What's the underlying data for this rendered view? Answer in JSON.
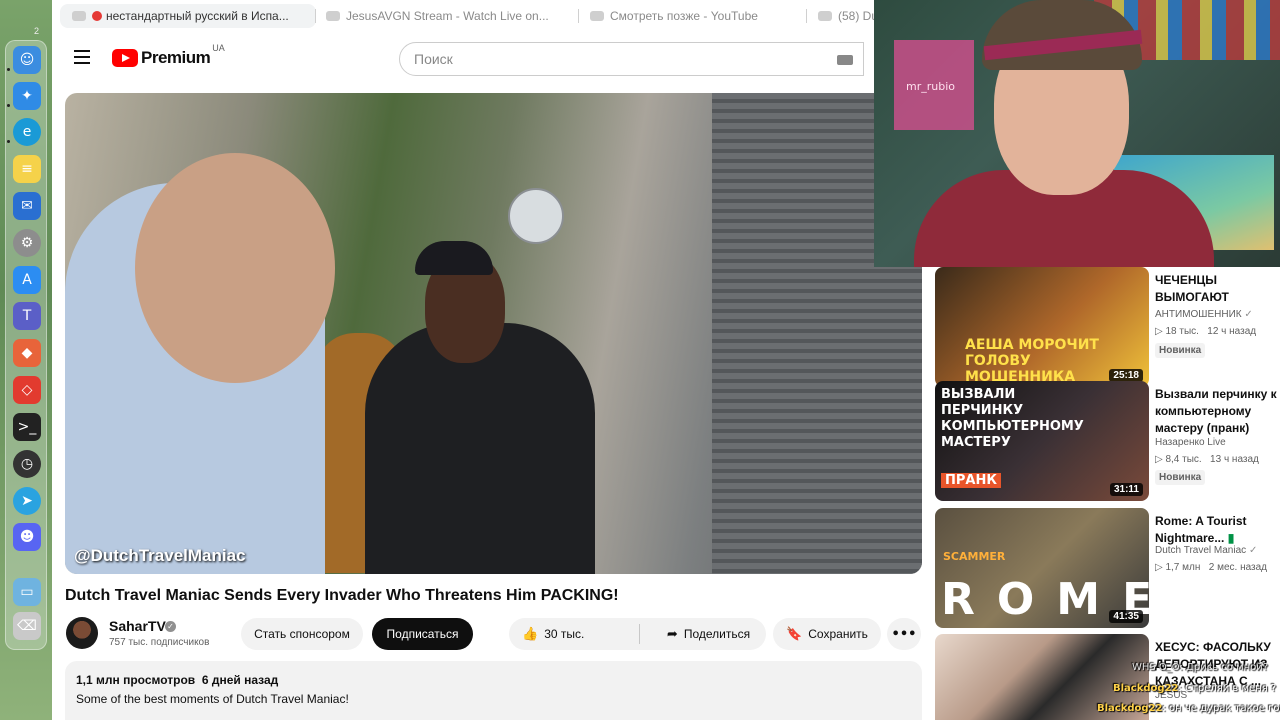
{
  "dock": {
    "counter": "2",
    "apps": [
      "finder-icon",
      "safari-icon",
      "edge-icon",
      "notes-icon",
      "outlook-icon",
      "settings-icon",
      "appstore-icon",
      "teams-icon",
      "office-icon",
      "anydesk-icon",
      "terminal-icon",
      "screen-time-icon",
      "telegram-icon",
      "discord-icon",
      "folder-icon",
      "trash-icon"
    ]
  },
  "tabs": [
    {
      "label": "нестандартный русский в Испа..."
    },
    {
      "label": "JesusAVGN Stream - Watch Live on..."
    },
    {
      "label": "Смотреть позже - YouTube"
    },
    {
      "label": "(58) Du"
    }
  ],
  "header": {
    "logo_text": "Premium",
    "country_code": "UA",
    "search_placeholder": "Поиск"
  },
  "video": {
    "watermark": "@DutchTravelManiac",
    "title": "Dutch Travel Maniac Sends Every Invader Who Threatens Him PACKING!"
  },
  "channel": {
    "name": "SaharTV",
    "subscribers": "757 тыс. подписчиков",
    "sponsor_label": "Стать спонсором",
    "subscribe_label": "Подписаться"
  },
  "actions": {
    "likes": "30 тыс.",
    "share_label": "Поделиться",
    "save_label": "Сохранить"
  },
  "description": {
    "views": "1,1 млн просмотров",
    "date": "6 дней назад",
    "text": "Some of the best moments of Dutch Travel Maniac!"
  },
  "recommendations": [
    {
      "title": "ЧЕЧЕНЦЫ ВЫМОГАЮТ ДЕНЬГ...",
      "channel": "АНТИМОШЕННИК",
      "views": "18 тыс.",
      "age": "12 ч назад",
      "badge": "Новинка",
      "duration": "25:18",
      "thumb_text": "АЕША МОРОЧИТ ГОЛОВУ МОШЕННИКА"
    },
    {
      "title": "Вызвали перчинку к компьютерному мастеру (пранк)",
      "channel": "Назаренко Live",
      "views": "8,4 тыс.",
      "age": "13 ч назад",
      "badge": "Новинка",
      "duration": "31:11",
      "thumb_text": "ВЫЗВАЛИ ПЕРЧИНКУ КОМПЬЮТЕРНОМУ МАСТЕРУ",
      "thumb_tag": "ПРАНК"
    },
    {
      "title": "Rome: A Tourist Nightmare...",
      "channel": "Dutch Travel Maniac",
      "views": "1,7 млн",
      "age": "2 мес. назад",
      "duration": "41:35",
      "thumb_text": "ROME",
      "thumb_tag": "SCAMMER"
    },
    {
      "title": "ХЕСУС: ФАСОЛЬКУ ДЕПОРТИРУЮТ ИЗ КАЗАХСТАНА С ...",
      "channel": "JESUS"
    }
  ],
  "chat": [
    {
      "name": "Blackdog22",
      "msg": ": Стреляй в меня ?"
    },
    {
      "name": "Blackdog22",
      "msg": ": он че дурак такое говорить ?"
    }
  ],
  "chat_partial": "WHS O_O: Дрись со мной?",
  "facecam": {
    "neon_text": "mr_rubio"
  }
}
